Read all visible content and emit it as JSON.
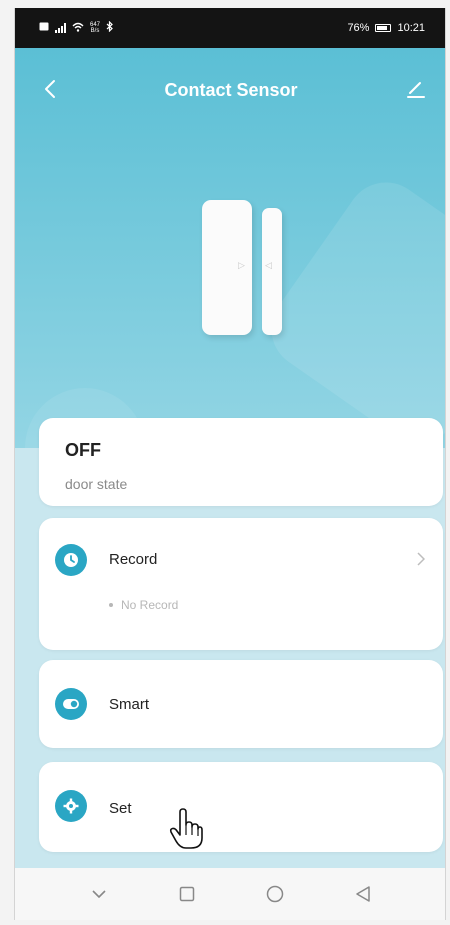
{
  "status_bar": {
    "network_speed_top": "647",
    "network_speed_bottom": "B/s",
    "battery": "76%",
    "time": "10:21"
  },
  "header": {
    "title": "Contact Sensor"
  },
  "state_card": {
    "value": "OFF",
    "label": "door state"
  },
  "record_card": {
    "label": "Record",
    "empty_text": "No Record"
  },
  "smart_card": {
    "label": "Smart"
  },
  "set_card": {
    "label": "Set"
  },
  "icons": {
    "back": "chevron-left-icon",
    "edit": "pencil-icon",
    "record": "clock-icon",
    "smart": "toggle-icon",
    "set": "gear-icon",
    "nav_down": "chevron-down-icon",
    "nav_recent": "square-icon",
    "nav_home": "circle-icon",
    "nav_back": "triangle-back-icon"
  },
  "colors": {
    "accent": "#2aa6c4",
    "hero_top": "#5bbfd5",
    "background": "#c9e7ef"
  }
}
